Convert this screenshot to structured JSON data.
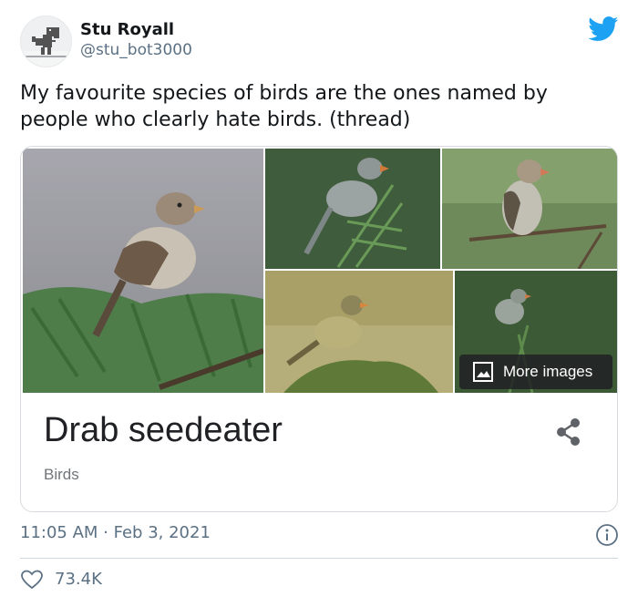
{
  "author": {
    "display_name": "Stu Royall",
    "handle": "@stu_bot3000",
    "avatar_icon": "dinosaur-icon"
  },
  "brand": {
    "icon": "twitter-bird-icon",
    "color": "#1da1f2"
  },
  "tweet": {
    "text": "My favourite species of birds are the ones named by people who clearly hate birds. (thread)"
  },
  "card": {
    "title": "Drab seedeater",
    "subtitle": "Birds",
    "more_images_label": "More images",
    "images": [
      "bird-photo-1",
      "bird-photo-2",
      "bird-photo-3",
      "bird-photo-4",
      "bird-photo-5"
    ]
  },
  "meta": {
    "timestamp": "11:05 AM · Feb 3, 2021",
    "likes": "73.4K"
  }
}
